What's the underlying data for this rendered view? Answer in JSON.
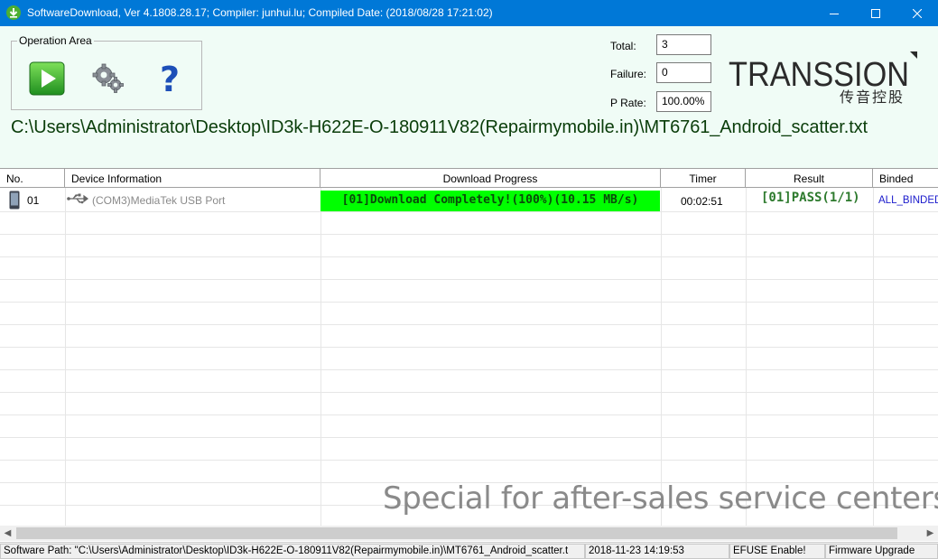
{
  "window": {
    "title": "SoftwareDownload, Ver 4.1808.28.17; Compiler: junhui.lu; Compiled Date: (2018/08/28 17:21:02)",
    "icons": [
      "download-arrow-icon",
      "minimize-icon",
      "maximize-icon",
      "close-icon"
    ]
  },
  "operation_area": {
    "legend": "Operation Area",
    "buttons": [
      "play-icon",
      "gear-icon",
      "help-icon"
    ]
  },
  "stats": {
    "total_label": "Total:",
    "total_value": "3",
    "failure_label": "Failure:",
    "failure_value": "0",
    "prate_label": "P Rate:",
    "prate_value": "100.00%"
  },
  "logo": {
    "brand": "TRANSSION",
    "chinese": "传音控股"
  },
  "scatter_path": "C:\\Users\\Administrator\\Desktop\\ID3k-H622E-O-180911V82(Repairmymobile.in)\\MT6761_Android_scatter.txt",
  "table": {
    "columns": [
      "No.",
      "Device Information",
      "Download Progress",
      "Timer",
      "Result",
      "Binded"
    ],
    "rows": [
      {
        "no": "01",
        "device": "(COM3)MediaTek USB Port",
        "progress": "[01]Download Completely!(100%)(10.15 MB/s)",
        "progress_percent": 100,
        "timer": "00:02:51",
        "result": "[01]PASS(1/1)",
        "binded": "ALL_BINDED"
      }
    ]
  },
  "watermark": "Special for after-sales service centers",
  "statusbar": {
    "software_path": "Software Path: \"C:\\Users\\Administrator\\Desktop\\ID3k-H622E-O-180911V82(Repairmymobile.in)\\MT6761_Android_scatter.t",
    "datetime": "2018-11-23 14:19:53",
    "efuse": "EFUSE Enable!",
    "mode": "Firmware Upgrade"
  },
  "colors": {
    "titlebar": "#0078d7",
    "upper_bg": "#f0fcf6",
    "progress_fill": "#00ff00",
    "result_text": "#2d7a2d",
    "binded_text": "#1a1acc"
  }
}
